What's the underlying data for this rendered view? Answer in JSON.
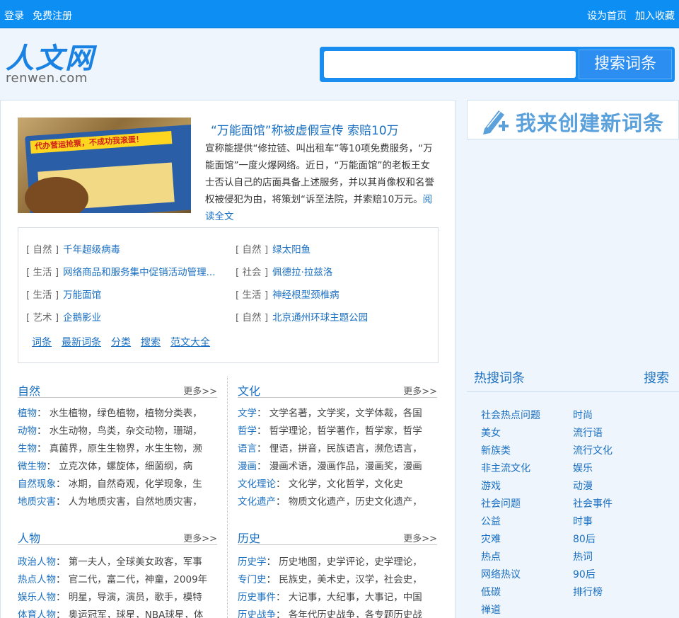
{
  "topbar": {
    "login": "登录",
    "register": "免费注册",
    "set_home": "设为首页",
    "favorite": "加入收藏"
  },
  "logo": {
    "cn": "人文网",
    "en": "renwen.com"
  },
  "search": {
    "placeholder": "",
    "button": "搜索词条"
  },
  "feature": {
    "image_text": "代办营运抢票，不成功我滚蛋！",
    "title": "“万能面馆”称被虚假宣传 索赔10万",
    "desc": "宣称能提供“修拉链、叫出租车”等10项免费服务，“万能面馆”一度火爆网络。近日，“万能面馆”的老板王女士否认自己的店面具备上述服务，并以其肖像权和名誉权被侵犯为由，将策划“诉至法院，并索赔10万元。",
    "more": "阅读全文"
  },
  "news": [
    {
      "cat": "[ 自然 ]",
      "title": "千年超级病毒"
    },
    {
      "cat": "[ 自然 ]",
      "title": "绿太阳鱼"
    },
    {
      "cat": "[ 生活 ]",
      "title": "网络商品和服务集中促销活动管理..."
    },
    {
      "cat": "[ 社会 ]",
      "title": "佩德拉·拉兹洛"
    },
    {
      "cat": "[ 生活 ]",
      "title": "万能面馆"
    },
    {
      "cat": "[ 生活 ]",
      "title": "神经根型颈椎病"
    },
    {
      "cat": "[ 艺术 ]",
      "title": "企鹅影业"
    },
    {
      "cat": "[ 自然 ]",
      "title": "北京通州环球主题公园"
    }
  ],
  "bottom_links": [
    "词条",
    "最新词条",
    "分类",
    "搜索",
    "范文大全"
  ],
  "more_label": "更多>>",
  "categories": [
    {
      "title": "自然",
      "rows": [
        {
          "k": "植物",
          "v": "水生植物，绿色植物，植物分类表，"
        },
        {
          "k": "动物",
          "v": "水生动物，鸟类，杂交动物，珊瑚，"
        },
        {
          "k": "生物",
          "v": "真菌界，原生生物界，水生生物，濒"
        },
        {
          "k": "微生物",
          "v": "立克次体，螺旋体，细菌纲，病"
        },
        {
          "k": "自然现象",
          "v": "冰期，自然奇观，化学现象，生"
        },
        {
          "k": "地质灾害",
          "v": "人为地质灾害，自然地质灾害，"
        }
      ]
    },
    {
      "title": "文化",
      "rows": [
        {
          "k": "文学",
          "v": "文学名著，文学奖，文学体裁，各国"
        },
        {
          "k": "哲学",
          "v": "哲学理论，哲学著作，哲学家，哲学"
        },
        {
          "k": "语言",
          "v": "俚语，拼音，民族语言，濒危语言，"
        },
        {
          "k": "漫画",
          "v": "漫画术语，漫画作品，漫画奖，漫画"
        },
        {
          "k": "文化理论",
          "v": "文化学，文化哲学，文化史"
        },
        {
          "k": "文化遗产",
          "v": "物质文化遗产，历史文化遗产，"
        }
      ]
    },
    {
      "title": "人物",
      "rows": [
        {
          "k": "政治人物",
          "v": "第一夫人，全球美女政客，军事"
        },
        {
          "k": "热点人物",
          "v": "官二代，富二代，神童，2009年"
        },
        {
          "k": "娱乐人物",
          "v": "明星，导演，演员，歌手，模特"
        },
        {
          "k": "体育人物",
          "v": "奥运冠军，球星，NBA球星，体"
        }
      ]
    },
    {
      "title": "历史",
      "rows": [
        {
          "k": "历史学",
          "v": "历史地图，史学评论，史学理论，"
        },
        {
          "k": "专门史",
          "v": "民族史，美术史，汉学，社会史，"
        },
        {
          "k": "历史事件",
          "v": "大记事，大纪事，大事记，中国"
        },
        {
          "k": "历史战争",
          "v": "各年代历史战争，各专题历史战"
        }
      ]
    }
  ],
  "sidebar": {
    "create": "我来创建新词条",
    "hot_title": "热搜词条",
    "hot_search": "搜索",
    "hot_col1": [
      "社会热点问题",
      "美女",
      "新族类",
      "非主流文化",
      "游戏",
      "社会问题",
      "公益",
      "灾难",
      "热点",
      "网络热议",
      "低碳",
      "禅道"
    ],
    "hot_col2": [
      "时尚",
      "流行语",
      "流行文化",
      "娱乐",
      "动漫",
      "社会事件",
      "时事",
      "80后",
      "热词",
      "90后",
      "排行榜"
    ]
  }
}
